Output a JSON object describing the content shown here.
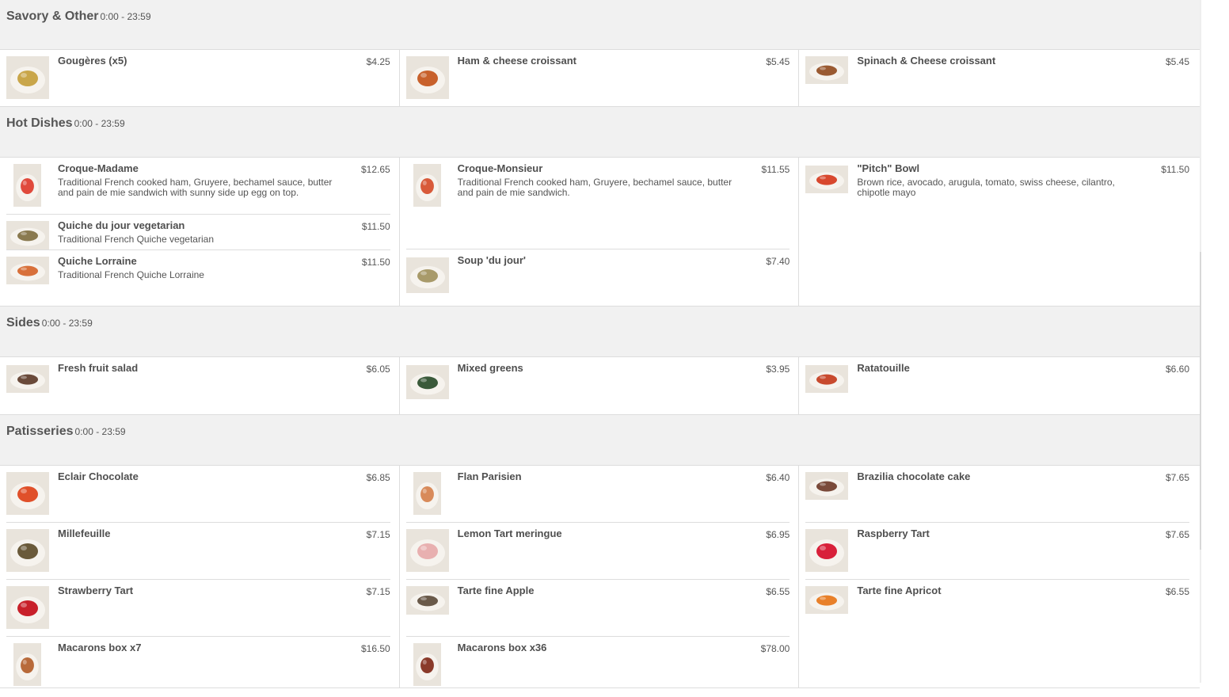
{
  "sections": [
    {
      "title": "Savory & Other",
      "hours": "0:00 - 23:59",
      "columns": [
        [
          {
            "name": "Gougères (x5)",
            "price": "$4.25",
            "desc": "",
            "img": "gougeres",
            "fill": "#c9a64a"
          }
        ],
        [
          {
            "name": "Ham & cheese croissant",
            "price": "$5.45",
            "desc": "",
            "img": "croissant-plate",
            "fill": "#c8612c"
          }
        ],
        [
          {
            "name": "Spinach & Cheese croissant",
            "price": "$5.45",
            "desc": "",
            "img": "croissant-small",
            "fill": "#9a5a32"
          }
        ]
      ]
    },
    {
      "title": "Hot Dishes",
      "hours": "0:00 - 23:59",
      "columns": [
        [
          {
            "name": "Croque-Madame",
            "price": "$12.65",
            "desc": "Traditional French cooked ham, Gruyere, bechamel sauce, butter and pain de mie sandwich with sunny side up egg on top.",
            "img": "croque-madame",
            "fill": "#e04a3c"
          },
          {
            "name": "Quiche du jour vegetarian",
            "price": "$11.50",
            "desc": "Traditional French Quiche vegetarian",
            "img": "quiche-veg",
            "fill": "#8a7a50"
          },
          {
            "name": "Quiche Lorraine",
            "price": "$11.50",
            "desc": "Traditional French Quiche Lorraine",
            "img": "quiche-lorraine",
            "fill": "#d8703a"
          }
        ],
        [
          {
            "name": "Croque-Monsieur",
            "price": "$11.55",
            "desc": "Traditional French cooked ham, Gruyere, bechamel sauce, butter and pain de mie sandwich.",
            "img": "croque-monsieur",
            "fill": "#d85a3a"
          },
          {
            "name": "Soup 'du jour'",
            "price": "$7.40",
            "desc": "",
            "img": "soup",
            "fill": "#a89a6a"
          }
        ],
        [
          {
            "name": "\"Pitch\" Bowl",
            "price": "$11.50",
            "desc": "Brown rice, avocado, arugula, tomato, swiss cheese, cilantro, chipotle mayo",
            "img": "bowl",
            "fill": "#d8482e"
          }
        ]
      ]
    },
    {
      "title": "Sides",
      "hours": "0:00 - 23:59",
      "columns": [
        [
          {
            "name": "Fresh fruit salad",
            "price": "$6.05",
            "desc": "",
            "img": "fruit-salad",
            "fill": "#6a4a3a"
          }
        ],
        [
          {
            "name": "Mixed greens",
            "price": "$3.95",
            "desc": "",
            "img": "greens",
            "fill": "#3a5a3a"
          }
        ],
        [
          {
            "name": "Ratatouille",
            "price": "$6.60",
            "desc": "",
            "img": "ratatouille",
            "fill": "#c84a2e"
          }
        ]
      ]
    },
    {
      "title": "Patisseries",
      "hours": "0:00 - 23:59",
      "columns": [
        [
          {
            "name": "Eclair Chocolate",
            "price": "$6.85",
            "desc": "",
            "img": "eclair",
            "fill": "#e0502a"
          },
          {
            "name": "Millefeuille",
            "price": "$7.15",
            "desc": "",
            "img": "millefeuille",
            "fill": "#6a5a3a"
          },
          {
            "name": "Strawberry Tart",
            "price": "$7.15",
            "desc": "",
            "img": "strawberry-tart",
            "fill": "#c8202a"
          },
          {
            "name": "Macarons box x7",
            "price": "$16.50",
            "desc": "",
            "img": "macarons-7",
            "fill": "#b86a3a"
          }
        ],
        [
          {
            "name": "Flan Parisien",
            "price": "$6.40",
            "desc": "",
            "img": "flan",
            "fill": "#d88a5a"
          },
          {
            "name": "Lemon Tart meringue",
            "price": "$6.95",
            "desc": "",
            "img": "lemon-tart",
            "fill": "#e8b0b0"
          },
          {
            "name": "Tarte fine Apple",
            "price": "$6.55",
            "desc": "",
            "img": "apple-tart",
            "fill": "#6a5a4a"
          },
          {
            "name": "Macarons box x36",
            "price": "$78.00",
            "desc": "",
            "img": "macarons-36",
            "fill": "#8a3a2a"
          }
        ],
        [
          {
            "name": "Brazilia chocolate cake",
            "price": "$7.65",
            "desc": "",
            "img": "chocolate-cake",
            "fill": "#7a4a3a"
          },
          {
            "name": "Raspberry Tart",
            "price": "$7.65",
            "desc": "",
            "img": "raspberry-tart",
            "fill": "#d8203a"
          },
          {
            "name": "Tarte fine Apricot",
            "price": "$6.55",
            "desc": "",
            "img": "apricot-tart",
            "fill": "#e8802a"
          }
        ]
      ]
    }
  ]
}
